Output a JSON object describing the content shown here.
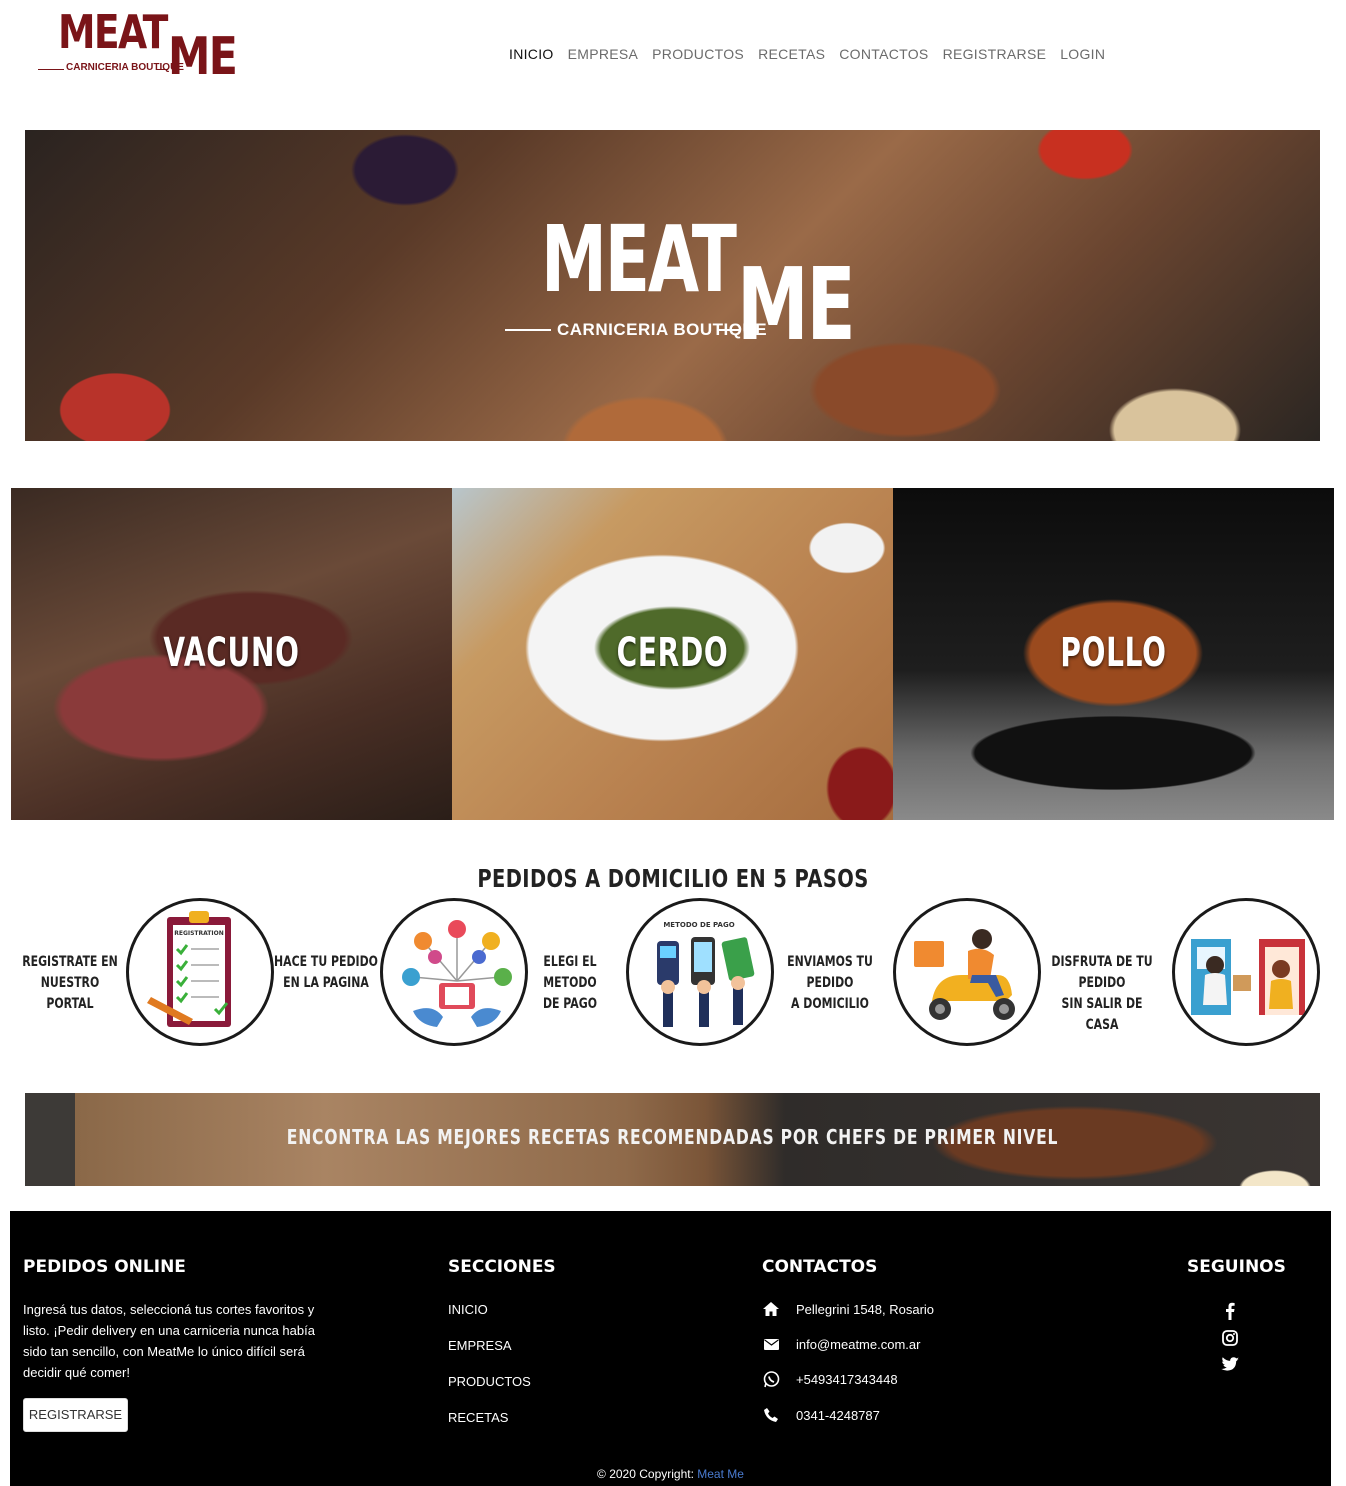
{
  "brand": {
    "logo_word1": "MEAT",
    "logo_word2": "ME",
    "logo_tagline": "CARNICERIA BOUTIQUE",
    "color": "#7a1418"
  },
  "nav": {
    "items": [
      {
        "label": "INICIO",
        "active": true
      },
      {
        "label": "EMPRESA",
        "active": false
      },
      {
        "label": "PRODUCTOS",
        "active": false
      },
      {
        "label": "RECETAS",
        "active": false
      },
      {
        "label": "CONTACTOS",
        "active": false
      },
      {
        "label": "REGISTRARSE",
        "active": false
      },
      {
        "label": "LOGIN",
        "active": false
      }
    ]
  },
  "hero": {
    "logo_word1": "MEAT",
    "logo_word2": "ME",
    "logo_tagline": "CARNICERIA BOUTIQUE"
  },
  "categories": [
    {
      "label": "VACUNO"
    },
    {
      "label": "CERDO"
    },
    {
      "label": "POLLO"
    }
  ],
  "steps": {
    "title": "PEDIDOS A DOMICILIO EN 5 PASOS",
    "items": [
      {
        "line1": "REGISTRATE EN",
        "line2": "NUESTRO PORTAL",
        "icon": "clipboard-registration-icon",
        "icon_caption": "REGISTRATION"
      },
      {
        "line1": "HACE TU PEDIDO",
        "line2": "EN LA PAGINA",
        "icon": "online-order-icon"
      },
      {
        "line1": "ELEGI EL METODO",
        "line2": "DE PAGO",
        "icon": "payment-method-icon",
        "icon_caption": "METODO DE PAGO"
      },
      {
        "line1": "ENVIAMOS TU PEDIDO",
        "line2": "A DOMICILIO",
        "icon": "delivery-scooter-icon"
      },
      {
        "line1": "DISFRUTA DE TU PEDIDO",
        "line2": "SIN SALIR DE CASA",
        "icon": "home-delivery-icon"
      }
    ]
  },
  "recipes_banner": {
    "text": "ENCONTRA LAS MEJORES RECETAS RECOMENDADAS POR CHEFS DE PRIMER NIVEL"
  },
  "footer": {
    "pedidos": {
      "heading": "PEDIDOS ONLINE",
      "text": "Ingresá tus datos, seleccioná tus cortes favoritos y listo. ¡Pedir delivery en una carniceria nunca había sido tan sencillo, con MeatMe lo único difícil será decidir qué comer!",
      "button": "REGISTRARSE"
    },
    "secciones": {
      "heading": "SECCIONES",
      "links": [
        "INICIO",
        "EMPRESA",
        "PRODUCTOS",
        "RECETAS"
      ]
    },
    "contactos": {
      "heading": "CONTACTOS",
      "address": "Pellegrini 1548, Rosario",
      "email": "info@meatme.com.ar",
      "whatsapp": "+5493417343448",
      "phone": "0341-4248787"
    },
    "seguinos": {
      "heading": "SEGUINOS",
      "icons": [
        "facebook-icon",
        "instagram-icon",
        "twitter-icon"
      ]
    },
    "copyright_prefix": "© 2020 Copyright: ",
    "copyright_brand": "Meat Me"
  }
}
